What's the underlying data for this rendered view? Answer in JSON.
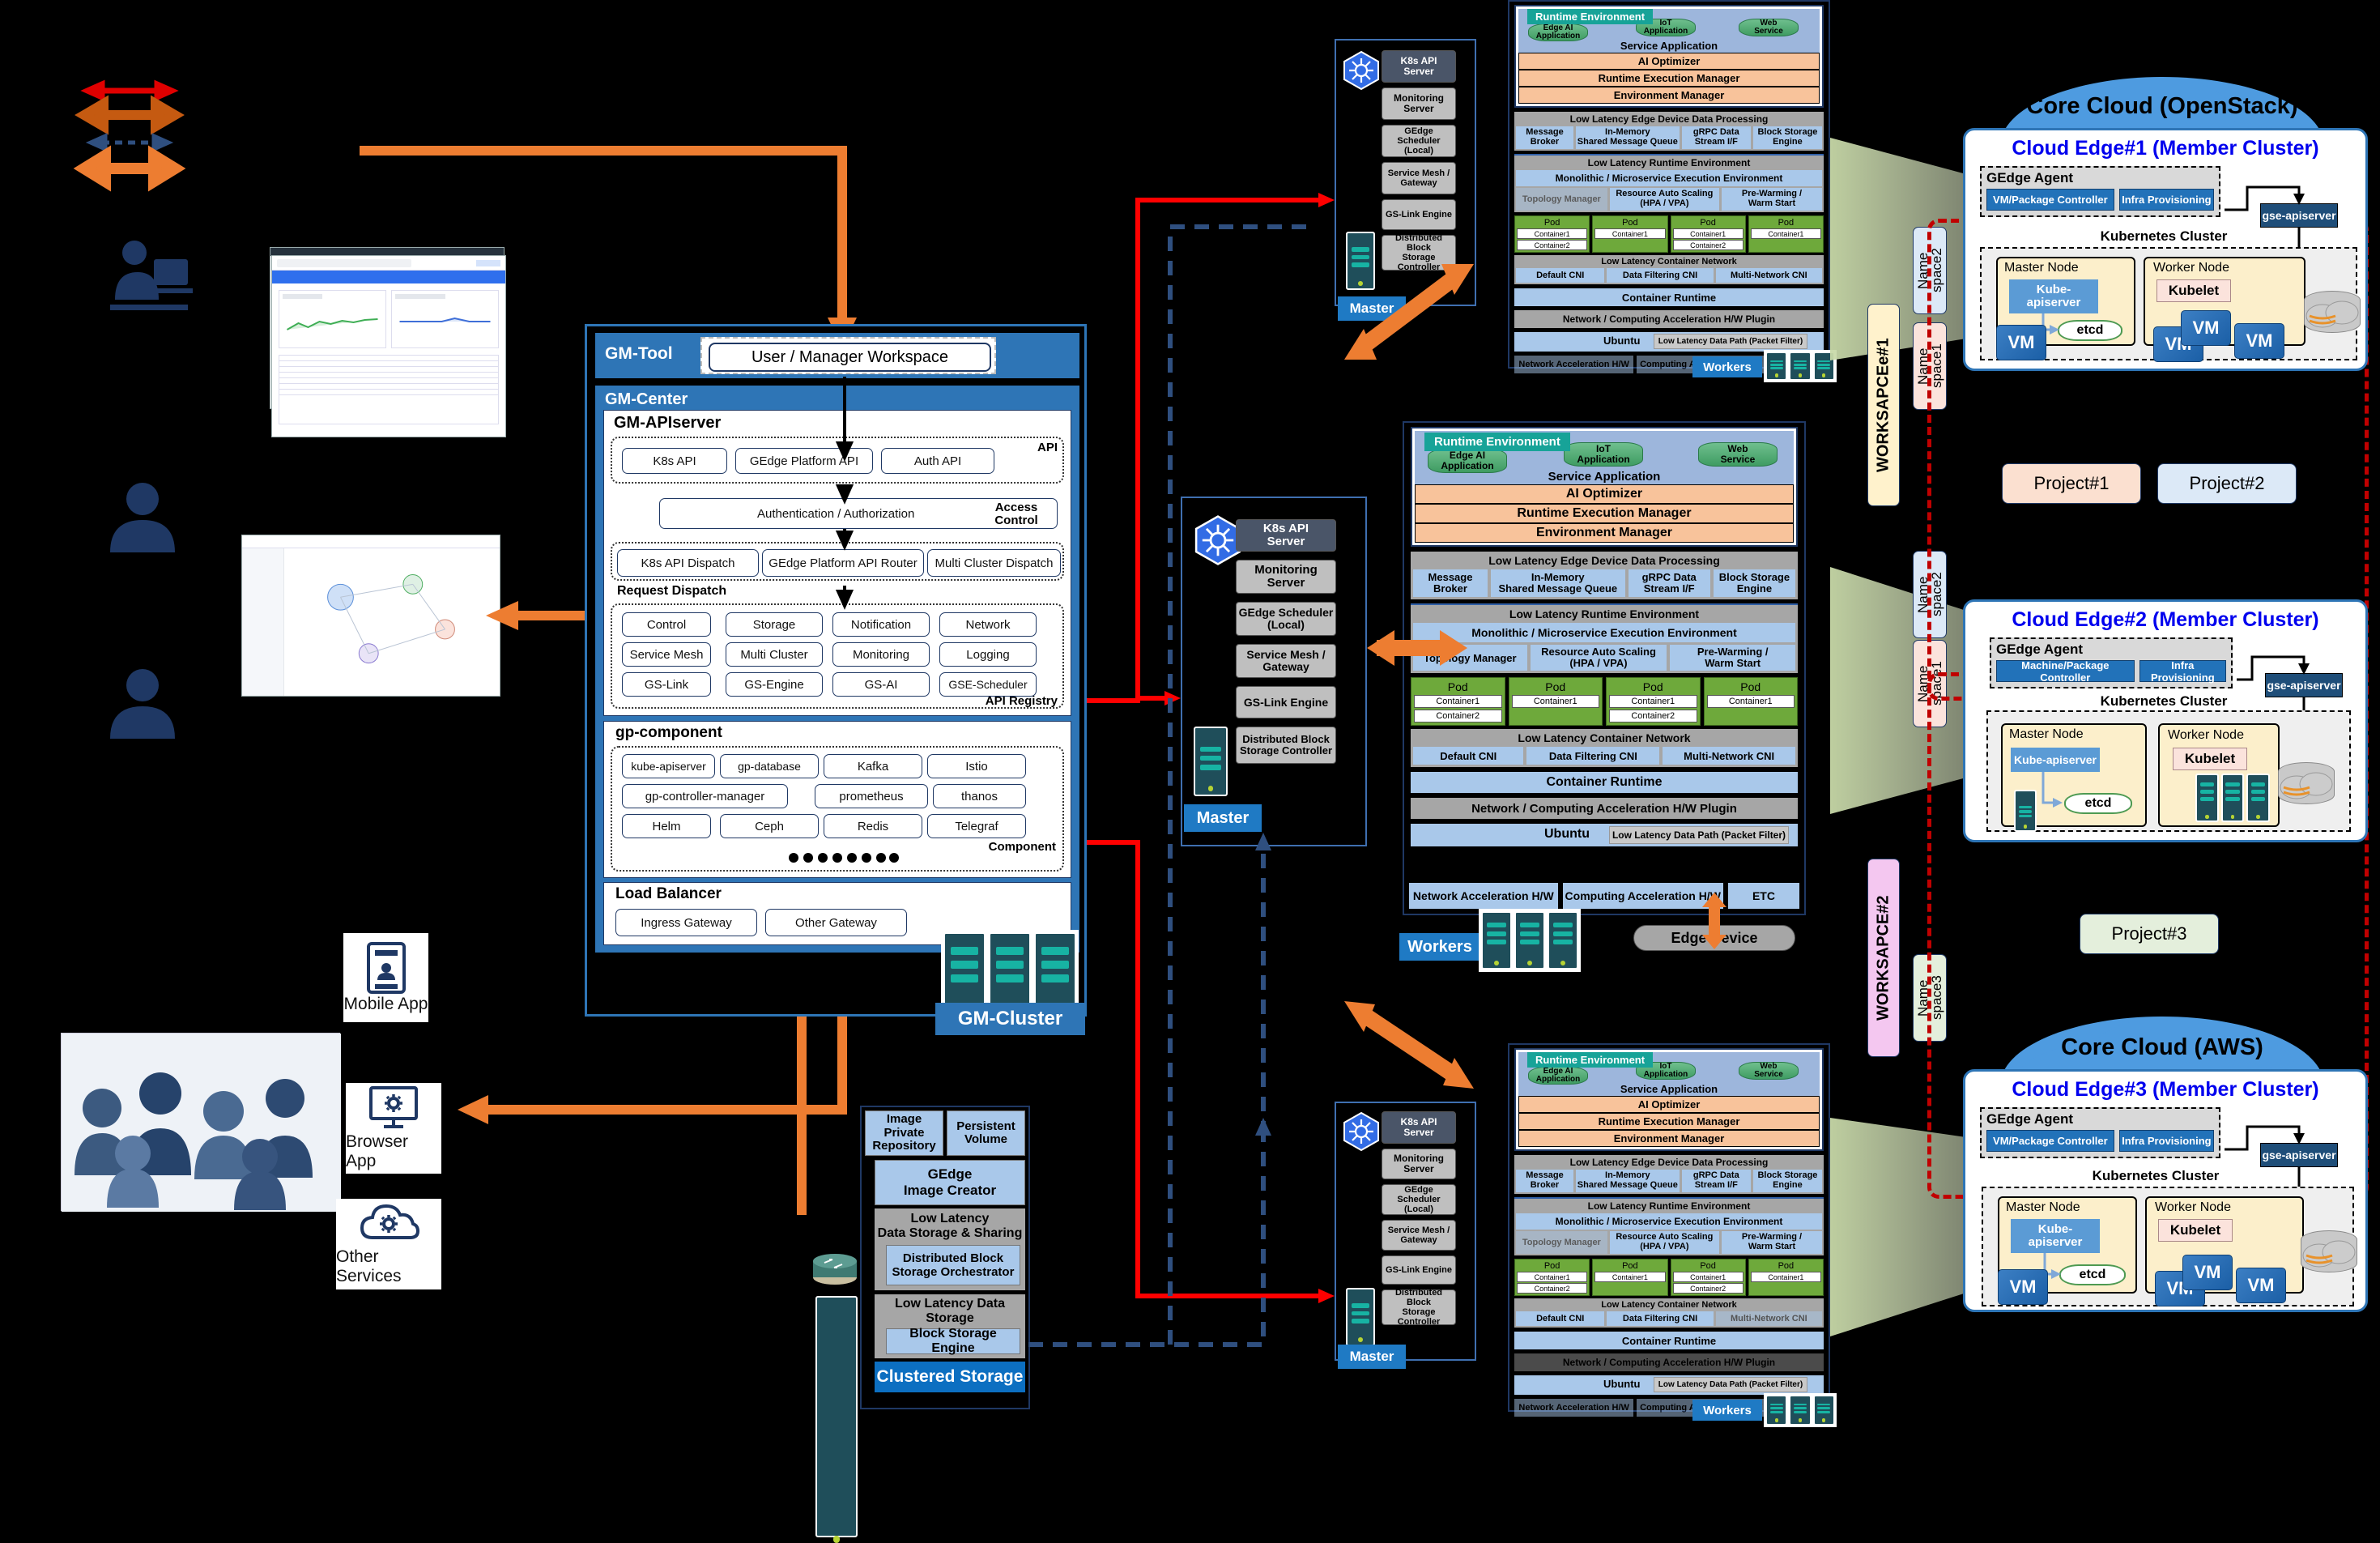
{
  "legend": {
    "arrows": [
      {
        "name": "red-bidirectional",
        "color": "#E00000"
      },
      {
        "name": "dark-orange-bidirectional",
        "color": "#C55A11"
      },
      {
        "name": "navy-dashed-bidirectional",
        "color": "#2F4F7F"
      },
      {
        "name": "orange-bidirectional",
        "color": "#ED7D31"
      }
    ]
  },
  "left_actors": {
    "mobile_app": "Mobile App",
    "browser_app": "Browser App",
    "other_services": "Other Services"
  },
  "gm": {
    "tool_title": "GM-Tool",
    "workspace": "User / Manager Workspace",
    "center_title": "GM-Center",
    "apiserver_title": "GM-APIserver",
    "api_group_label": "API",
    "api_items": [
      "K8s API",
      "GEdge Platform API",
      "Auth API"
    ],
    "access_control_label": "Access\nControl",
    "auth_box": "Authentication  /  Authorization",
    "dispatch_label": "Request Dispatch",
    "dispatch_items": [
      "K8s API Dispatch",
      "GEdge Platform API Router",
      "Multi Cluster Dispatch"
    ],
    "registry_label": "API Registry",
    "registry_items": [
      "Control",
      "Storage",
      "Notification",
      "Network",
      "Service Mesh",
      "Multi Cluster",
      "Monitoring",
      "Logging",
      "GS-Link",
      "GS-Engine",
      "GS-AI",
      "GSE-Scheduler"
    ],
    "gp_component_title": "gp-component",
    "component_label": "Component",
    "component_items": [
      "kube-apiserver",
      "gp-database",
      "Kafka",
      "Istio",
      "gp-controller-manager",
      "prometheus",
      "thanos",
      "Helm",
      "Ceph",
      "Redis",
      "Telegraf"
    ],
    "load_balancer_title": "Load Balancer",
    "gateways": [
      "Ingress Gateway",
      "Other Gateway"
    ],
    "cluster_tag": "GM-Cluster"
  },
  "storage": {
    "top_row": [
      "Image Private\nRepository",
      "Persistent\nVolume"
    ],
    "image_creator": "GEdge\nImage Creator",
    "low_latency_sharing": "Low Latency\nData Storage & Sharing",
    "dbso": "Distributed Block\nStorage Orchestrator",
    "low_latency_storage": "Low Latency Data Storage",
    "bse": "Block Storage Engine",
    "footer": "Clustered Storage"
  },
  "master_column": {
    "items": [
      "K8s API\nServer",
      "Monitoring\nServer",
      "GEdge Scheduler\n(Local)",
      "Service Mesh /\nGateway",
      "GS-Link Engine",
      "Distributed Block\nStorage Controller"
    ],
    "tag": "Master",
    "k8s_icon": "kubernetes-icon"
  },
  "edge_node": {
    "runtime_tag": "Runtime Environment",
    "apps": [
      "Edge AI\nApplication",
      "IoT\nApplication",
      "Web\nService"
    ],
    "service_application": "Service Application",
    "managers": [
      "AI Optimizer",
      "Runtime Execution Manager",
      "Environment Manager"
    ],
    "dp_title": "Low Latency Edge Device Data Processing",
    "dp_items": [
      "Message\nBroker",
      "In-Memory\nShared Message Queue",
      "gRPC Data\nStream I/F",
      "Block Storage\nEngine"
    ],
    "llrt_title": "Low Latency Runtime Environment",
    "mono": "Monolithic / Microservice Execution Environment",
    "mono_items": [
      "Topology Manager",
      "Resource Auto Scaling\n(HPA / VPA)",
      "Pre-Warming /\nWarm Start"
    ],
    "pods": [
      {
        "label": "Pod",
        "containers": [
          "Container1",
          "Container2"
        ]
      },
      {
        "label": "Pod",
        "containers": [
          "Container1"
        ]
      },
      {
        "label": "Pod",
        "containers": [
          "Container1",
          "Container2"
        ]
      },
      {
        "label": "Pod",
        "containers": [
          "Container1"
        ]
      }
    ],
    "cn_title": "Low Latency Container Network",
    "cni_items": [
      "Default CNI",
      "Data Filtering CNI",
      "Multi-Network CNI"
    ],
    "container_runtime": "Container Runtime",
    "hw_plugin": "Network / Computing Acceleration H/W Plugin",
    "os": "Ubuntu",
    "datapath": "Low Latency Data Path (Packet Filter)",
    "hw_items": [
      "Network Acceleration H/W",
      "Computing Acceleration H/W",
      "ETC"
    ],
    "workers_tag": "Workers",
    "edge_device": "Edge Device"
  },
  "clouds": [
    {
      "cloud_title": "Core Cloud (OpenStack)",
      "card_title": "Cloud Edge#1 (Member Cluster)",
      "agent_title": "GEdge Agent",
      "agent_items": [
        "VM/Package Controller",
        "Infra Provisioning"
      ],
      "gse": "gse-apiserver",
      "k8s_label": "Kubernetes  Cluster",
      "master_node": "Master Node",
      "worker_node": "Worker Node",
      "kube_apiserver": "Kube-\napiserver",
      "etcd": "etcd",
      "kubelet": "Kubelet",
      "vms": [
        "VM",
        "VM",
        "VM",
        "VM"
      ]
    },
    {
      "cloud_title": "",
      "card_title": "Cloud Edge#2 (Member Cluster)",
      "agent_title": "GEdge Agent",
      "agent_items": [
        "Machine/Package Controller",
        "Infra Provisioning"
      ],
      "gse": "gse-apiserver",
      "k8s_label": "Kubernetes  Cluster",
      "master_node": "Master Node",
      "worker_node": "Worker Node",
      "kube_apiserver": "Kube-apiserver",
      "etcd": "etcd",
      "kubelet": "Kubelet",
      "vms": []
    },
    {
      "cloud_title": "Core Cloud (AWS)",
      "card_title": "Cloud Edge#3 (Member Cluster)",
      "agent_title": "GEdge Agent",
      "agent_items": [
        "VM/Package Controller",
        "Infra Provisioning"
      ],
      "gse": "gse-apiserver",
      "k8s_label": "Kubernetes  Cluster",
      "master_node": "Master Node",
      "worker_node": "Worker Node",
      "kube_apiserver": "Kube-\napiserver",
      "etcd": "etcd",
      "kubelet": "Kubelet",
      "vms": [
        "VM",
        "VM",
        "VM"
      ]
    }
  ],
  "namespaces": [
    {
      "label": "Name\nspace2",
      "color": "#DCE9F7"
    },
    {
      "label": "Name\nspace1",
      "color": "#FBE3DC"
    },
    {
      "label": "Name\nspace2",
      "color": "#DCE9F7"
    },
    {
      "label": "Name\nspace1",
      "color": "#FBE3DC"
    },
    {
      "label": "Name\nspace3",
      "color": "#E4EFDC"
    }
  ],
  "workspaces": [
    {
      "label": "WORKSAPCEe#1",
      "color": "#FFF2CC"
    },
    {
      "label": "WORKSAPCE#2",
      "color": "#F4C7F0"
    }
  ],
  "projects": [
    {
      "label": "Project#1",
      "color": "#FBE0D0"
    },
    {
      "label": "Project#2",
      "color": "#DCE9F7"
    },
    {
      "label": "Project#3",
      "color": "#E4EFDC"
    }
  ]
}
